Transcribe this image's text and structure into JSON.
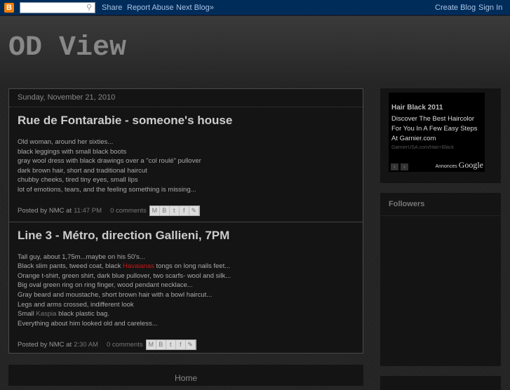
{
  "navbar": {
    "logo": "B",
    "share": "Share",
    "report_abuse": "Report Abuse",
    "next_blog": "Next Blog»",
    "create_blog": "Create Blog",
    "sign_in": "Sign In",
    "search_value": ""
  },
  "blog": {
    "title": "OD View"
  },
  "date_header": "Sunday, November 21, 2010",
  "posts": [
    {
      "title": "Rue de Fontarabie - someone's house",
      "lines": [
        "Old woman, around her sixties...",
        "black leggings with small black boots",
        "gray wool dress with black drawings over a \"col roulé\" pullover",
        "dark brown hair, short and traditional haircut",
        "chubby cheeks, tired tiny eyes, small lips",
        "lot of emotions, tears, and the feeling something is missing..."
      ],
      "posted_by": "Posted by NMC at",
      "time": "11:47 PM",
      "comments": "0 comments"
    },
    {
      "title": "Line 3 - Métro, direction Gallieni, 7PM",
      "lines": [
        "Tall guy, about 1,75m...maybe on his 50's...",
        "Black slim pants, tweed coat, black ",
        "Orange t-shirt, green shirt, dark blue pullover, two scarfs- wool and silk...",
        "Big oval green ring on ring finger, wood pendant necklace...",
        "Gray beard and moustache, short brown hair with a bowl haircut...",
        "Legs and arms crossed, indifferent look",
        "Small ",
        "Everything about him looked old and careless..."
      ],
      "link1": "Havaianas",
      "line2_rest": " tongs on long nails feet...",
      "link2": "Kaspia",
      "line7_rest": " black plastic bag.",
      "posted_by": "Posted by NMC at",
      "time": "2:30 AM",
      "comments": "0 comments"
    }
  ],
  "share_icons": [
    "M",
    "B",
    "t",
    "f",
    "✎"
  ],
  "ad": {
    "headline": "Hair Black 2011",
    "desc": "Discover The Best Haircolor For You In A Few Easy Steps At Garnier.com",
    "url": "GarnierUSA.com/Hair+Black",
    "prev": "‹",
    "next": "›",
    "annonces": "Annonces",
    "google": "Google"
  },
  "followers": {
    "title": "Followers"
  },
  "footer": {
    "home": "Home"
  }
}
